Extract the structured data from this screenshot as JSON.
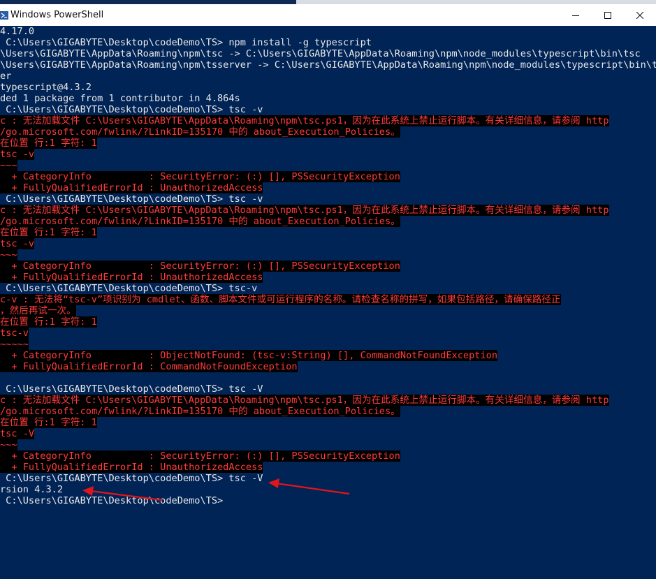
{
  "window": {
    "title": "Windows PowerShell"
  },
  "console": {
    "lines": [
      {
        "text": "4.17.0",
        "kind": "out"
      },
      {
        "text": " C:\\Users\\GIGABYTE\\Desktop\\codeDemo\\TS> npm install -g typescript",
        "kind": "out"
      },
      {
        "text": "\\Users\\GIGABYTE\\AppData\\Roaming\\npm\\tsc -> C:\\Users\\GIGABYTE\\AppData\\Roaming\\npm\\node_modules\\typescript\\bin\\tsc",
        "kind": "out"
      },
      {
        "text": "\\Users\\GIGABYTE\\AppData\\Roaming\\npm\\tsserver -> C:\\Users\\GIGABYTE\\AppData\\Roaming\\npm\\node_modules\\typescript\\bin\\tsse",
        "kind": "out"
      },
      {
        "text": "er",
        "kind": "out"
      },
      {
        "text": "typescript@4.3.2",
        "kind": "out"
      },
      {
        "text": "ded 1 package from 1 contributor in 4.864s",
        "kind": "out"
      },
      {
        "text": " C:\\Users\\GIGABYTE\\Desktop\\codeDemo\\TS> tsc -v",
        "kind": "out"
      },
      {
        "text": "c : 无法加载文件 C:\\Users\\GIGABYTE\\AppData\\Roaming\\npm\\tsc.ps1，因为在此系统上禁止运行脚本。有关详细信息，请参阅 http",
        "kind": "err"
      },
      {
        "text": "/go.microsoft.com/fwlink/?LinkID=135170 中的 about_Execution_Policies。",
        "kind": "err"
      },
      {
        "text": "在位置 行:1 字符: 1",
        "kind": "err"
      },
      {
        "text": "tsc -v",
        "kind": "err"
      },
      {
        "text": "~~~",
        "kind": "err"
      },
      {
        "text": "  + CategoryInfo          : SecurityError: (:) [], PSSecurityException",
        "kind": "err"
      },
      {
        "text": "  + FullyQualifiedErrorId : UnauthorizedAccess",
        "kind": "err"
      },
      {
        "text": " C:\\Users\\GIGABYTE\\Desktop\\codeDemo\\TS> tsc -v",
        "kind": "out"
      },
      {
        "text": "c : 无法加载文件 C:\\Users\\GIGABYTE\\AppData\\Roaming\\npm\\tsc.ps1，因为在此系统上禁止运行脚本。有关详细信息，请参阅 http",
        "kind": "err"
      },
      {
        "text": "/go.microsoft.com/fwlink/?LinkID=135170 中的 about_Execution_Policies。",
        "kind": "err"
      },
      {
        "text": "在位置 行:1 字符: 1",
        "kind": "err"
      },
      {
        "text": "tsc -v",
        "kind": "err"
      },
      {
        "text": "~~~",
        "kind": "err"
      },
      {
        "text": "  + CategoryInfo          : SecurityError: (:) [], PSSecurityException",
        "kind": "err"
      },
      {
        "text": "  + FullyQualifiedErrorId : UnauthorizedAccess",
        "kind": "err"
      },
      {
        "text": " C:\\Users\\GIGABYTE\\Desktop\\codeDemo\\TS> tsc-v",
        "kind": "out"
      },
      {
        "text": "c-v : 无法将“tsc-v”项识别为 cmdlet、函数、脚本文件或可运行程序的名称。请检查名称的拼写，如果包括路径，请确保路径正",
        "kind": "err"
      },
      {
        "text": "，然后再试一次。",
        "kind": "err"
      },
      {
        "text": "在位置 行:1 字符: 1",
        "kind": "err"
      },
      {
        "text": "tsc-v",
        "kind": "err"
      },
      {
        "text": "~~~~~",
        "kind": "err"
      },
      {
        "text": "  + CategoryInfo          : ObjectNotFound: (tsc-v:String) [], CommandNotFoundException",
        "kind": "err"
      },
      {
        "text": "  + FullyQualifiedErrorId : CommandNotFoundException",
        "kind": "err"
      },
      {
        "text": "",
        "kind": "out"
      },
      {
        "text": " C:\\Users\\GIGABYTE\\Desktop\\codeDemo\\TS> tsc -V",
        "kind": "out"
      },
      {
        "text": "c : 无法加载文件 C:\\Users\\GIGABYTE\\AppData\\Roaming\\npm\\tsc.ps1，因为在此系统上禁止运行脚本。有关详细信息，请参阅 http",
        "kind": "err"
      },
      {
        "text": "/go.microsoft.com/fwlink/?LinkID=135170 中的 about_Execution_Policies。",
        "kind": "err"
      },
      {
        "text": "在位置 行:1 字符: 1",
        "kind": "err"
      },
      {
        "text": "tsc -V",
        "kind": "err"
      },
      {
        "text": "~~~",
        "kind": "err"
      },
      {
        "text": "  + CategoryInfo          : SecurityError: (:) [], PSSecurityException",
        "kind": "err"
      },
      {
        "text": "  + FullyQualifiedErrorId : UnauthorizedAccess",
        "kind": "err"
      },
      {
        "text": " C:\\Users\\GIGABYTE\\Desktop\\codeDemo\\TS> tsc -V",
        "kind": "out"
      },
      {
        "text": "rsion 4.3.2",
        "kind": "out"
      },
      {
        "text": " C:\\Users\\GIGABYTE\\Desktop\\codeDemo\\TS>",
        "kind": "out"
      }
    ]
  },
  "colors": {
    "console_bg": "#012456",
    "error_fg": "#ff3b3b",
    "error_bg": "#000000",
    "output_fg": "#e8e8e8",
    "annotation_arrow": "#e3141b"
  },
  "icons": {
    "app": "powershell-icon",
    "minimize": "minimize-icon",
    "maximize": "maximize-icon",
    "close": "close-icon"
  }
}
